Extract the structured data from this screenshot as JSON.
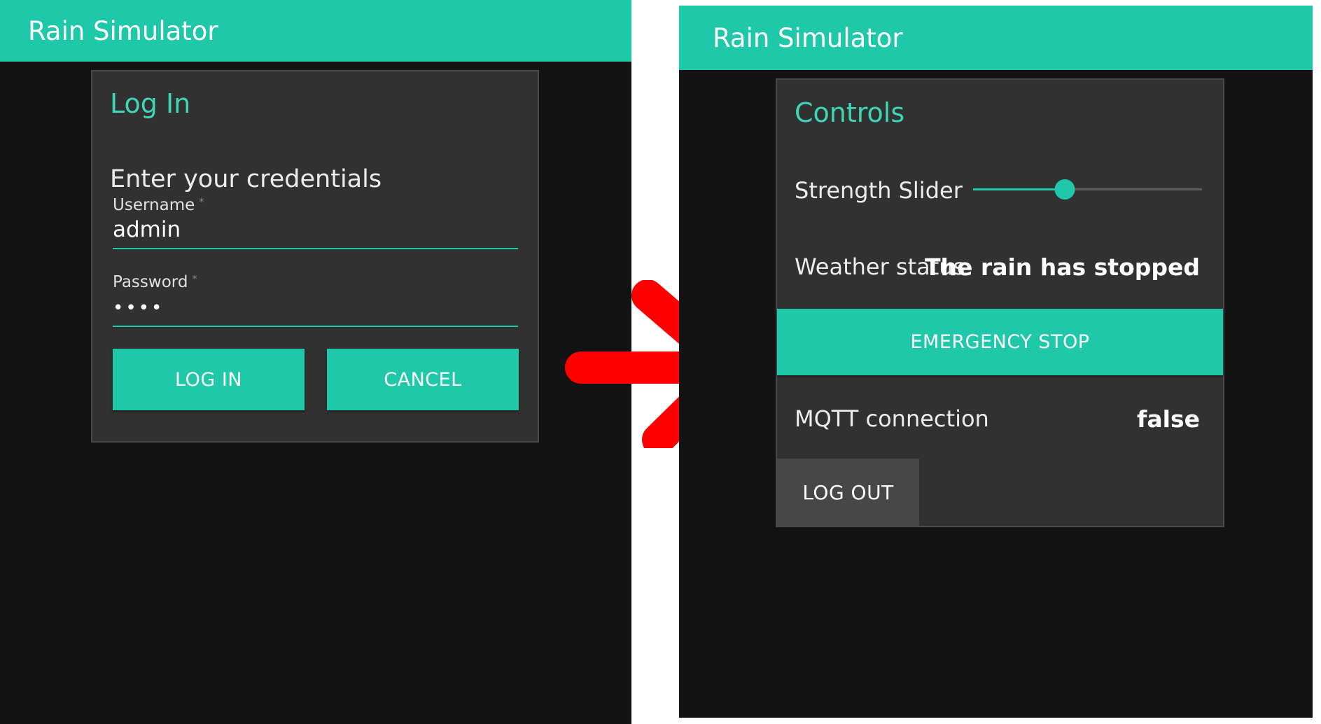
{
  "colors": {
    "accent": "#1ec8a8",
    "title_accent": "#3fd6b6",
    "background": "#121212",
    "card": "#313131",
    "arrow": "#ff0000"
  },
  "login_screen": {
    "app_title": "Rain Simulator",
    "card": {
      "title": "Log In",
      "subtitle": "Enter your credentials",
      "username": {
        "label": "Username",
        "required_marker": "*",
        "value": "admin"
      },
      "password": {
        "label": "Password",
        "required_marker": "*",
        "value": "••••"
      },
      "login_label": "LOG IN",
      "cancel_label": "CANCEL"
    }
  },
  "controls_screen": {
    "app_title": "Rain Simulator",
    "card": {
      "title": "Controls",
      "slider_label": "Strength Slider",
      "slider_value": 0.4,
      "weather_label": "Weather status",
      "weather_value": "The rain has stopped",
      "emergency_label": "EMERGENCY STOP",
      "mqtt_label": "MQTT connection",
      "mqtt_value": "false",
      "logout_label": "LOG OUT"
    }
  },
  "transition_arrow": {
    "icon": "arrow-right-icon"
  }
}
